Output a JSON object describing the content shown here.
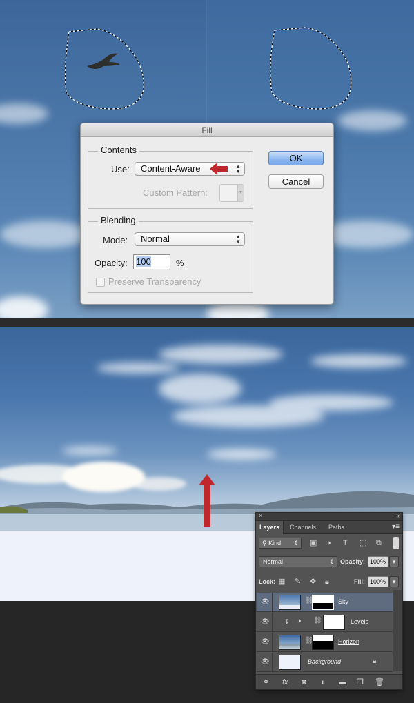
{
  "fill_dialog": {
    "title": "Fill",
    "contents_group": "Contents",
    "use_label": "Use:",
    "use_value": "Content-Aware",
    "custom_pattern_label": "Custom Pattern:",
    "blending_group": "Blending",
    "mode_label": "Mode:",
    "mode_value": "Normal",
    "opacity_label": "Opacity:",
    "opacity_value": "100",
    "opacity_unit": "%",
    "preserve_transparency": "Preserve Transparency",
    "preserve_transparency_checked": false,
    "ok": "OK",
    "cancel": "Cancel"
  },
  "layers_panel": {
    "tabs": [
      "Layers",
      "Channels",
      "Paths"
    ],
    "active_tab": "Layers",
    "filter_kind": "Kind",
    "blend_mode": "Normal",
    "opacity_label": "Opacity:",
    "opacity_value": "100%",
    "lock_label": "Lock:",
    "fill_label": "Fill:",
    "fill_value": "100%",
    "layers": [
      {
        "name": "Sky",
        "selected": true,
        "visible": true
      },
      {
        "name": "Levels",
        "selected": false,
        "visible": true
      },
      {
        "name": "Horizon",
        "selected": false,
        "visible": true
      },
      {
        "name": "Background",
        "selected": false,
        "visible": true,
        "locked": true
      }
    ]
  },
  "colors": {
    "accent_arrow": "#c0272d",
    "selected_layer": "#5f6c80",
    "ok_button": "#8ab6ef"
  }
}
